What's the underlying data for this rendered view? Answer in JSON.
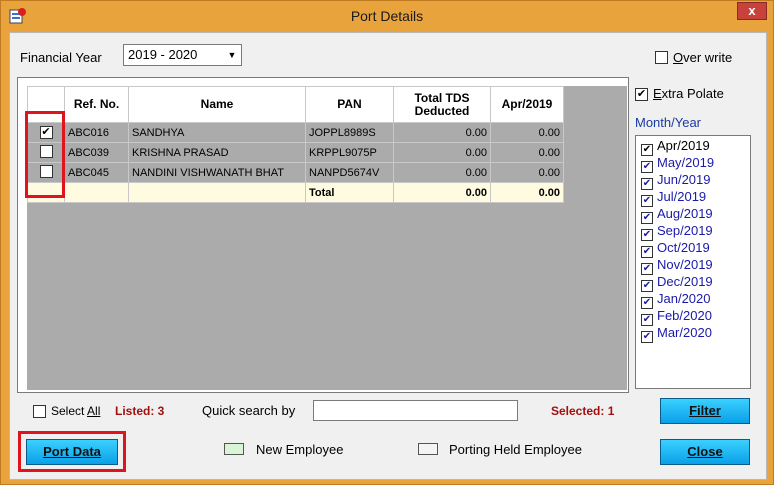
{
  "window": {
    "title": "Port Details",
    "close_glyph": "x"
  },
  "header": {
    "financial_year_label": "Financial Year",
    "financial_year_value": "2019 - 2020",
    "overwrite_label": "Over write",
    "overwrite_checked": false
  },
  "grid": {
    "columns": [
      "Ref. No.",
      "Name",
      "PAN",
      "Total TDS\nDeducted",
      "Apr/2019"
    ],
    "rows": [
      {
        "checked": true,
        "ref": "ABC016",
        "name": "SANDHYA",
        "pan": "JOPPL8989S",
        "tds": "0.00",
        "apr": "0.00"
      },
      {
        "checked": false,
        "ref": "ABC039",
        "name": "KRISHNA PRASAD",
        "pan": "KRPPL9075P",
        "tds": "0.00",
        "apr": "0.00"
      },
      {
        "checked": false,
        "ref": "ABC045",
        "name": "NANDINI VISHWANATH BHAT",
        "pan": "NANPD5674V",
        "tds": "0.00",
        "apr": "0.00"
      }
    ],
    "total": {
      "label": "Total",
      "tds": "0.00",
      "apr": "0.00"
    }
  },
  "right_panel": {
    "extra_polate_label": "Extra Polate",
    "extra_polate_checked": true,
    "month_year_label": "Month/Year",
    "months": [
      "Apr/2019",
      "May/2019",
      "Jun/2019",
      "Jul/2019",
      "Aug/2019",
      "Sep/2019",
      "Oct/2019",
      "Nov/2019",
      "Dec/2019",
      "Jan/2020",
      "Feb/2020",
      "Mar/2020"
    ]
  },
  "footer": {
    "select_all_label": "Select All",
    "listed_text": "Listed: 3",
    "quick_search_label": "Quick search by",
    "quick_search_value": "",
    "selected_text": "Selected: 1",
    "filter_label": "Filter",
    "port_data_label": "Port Data",
    "legend_new": "New Employee",
    "legend_held": "Porting Held Employee",
    "close_label": "Close"
  },
  "colors": {
    "frame": "#e8a33d",
    "accent_red": "#e0141c",
    "button": "#1ab8f5",
    "month_text": "#1a1aa8"
  }
}
